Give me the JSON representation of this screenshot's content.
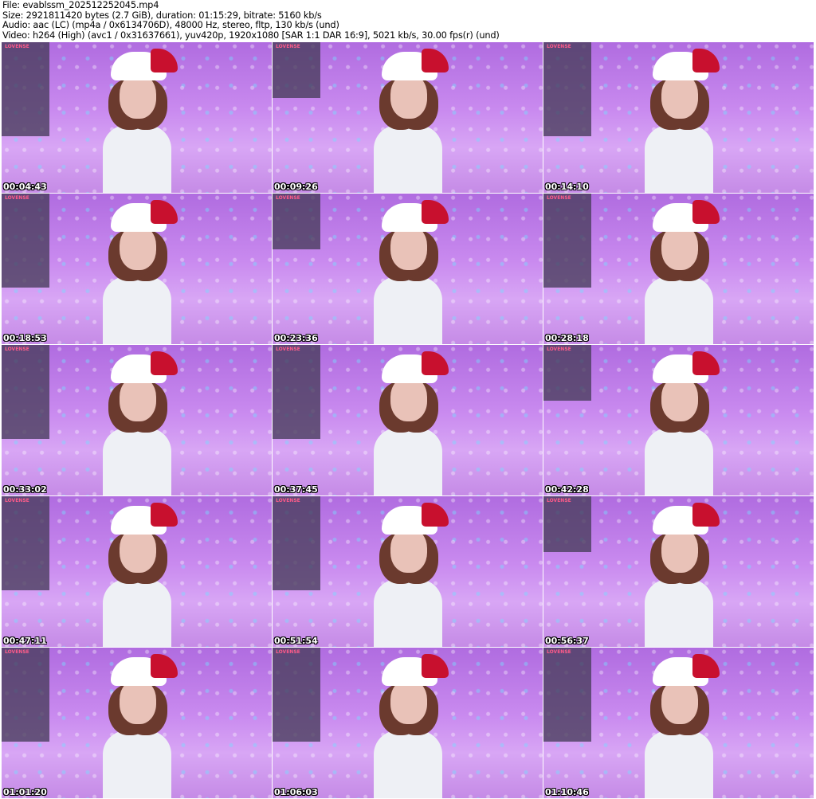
{
  "header": {
    "file": "File: evablssm_202512252045.mp4",
    "size": "Size: 2921811420 bytes (2.7 GiB), duration: 01:15:29, bitrate: 5160 kb/s",
    "audio": "Audio: aac (LC) (mp4a / 0x6134706D), 48000 Hz, stereo, fltp, 130 kb/s (und)",
    "video": "Video: h264 (High) (avc1 / 0x31637661), yuv420p, 1920x1080 [SAR 1:1 DAR 16:9], 5021 kb/s, 30.00 fps(r) (und)"
  },
  "overlay_brand": "LOVENSE",
  "thumbnails": [
    {
      "time": "00:04:43"
    },
    {
      "time": "00:09:26"
    },
    {
      "time": "00:14:10"
    },
    {
      "time": "00:18:53"
    },
    {
      "time": "00:23:36"
    },
    {
      "time": "00:28:18"
    },
    {
      "time": "00:33:02"
    },
    {
      "time": "00:37:45"
    },
    {
      "time": "00:42:28"
    },
    {
      "time": "00:47:11"
    },
    {
      "time": "00:51:54"
    },
    {
      "time": "00:56:37"
    },
    {
      "time": "01:01:20"
    },
    {
      "time": "01:06:03"
    },
    {
      "time": "01:10:46"
    }
  ]
}
